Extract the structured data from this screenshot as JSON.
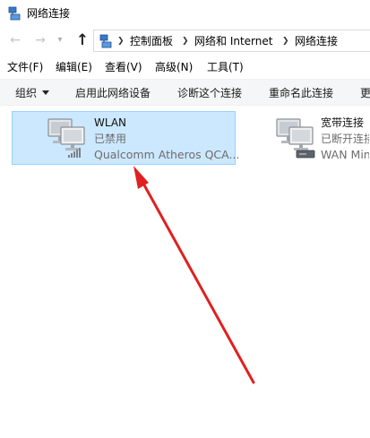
{
  "window": {
    "title": "网络连接"
  },
  "address": {
    "crumbs": [
      "控制面板",
      "网络和 Internet",
      "网络连接"
    ]
  },
  "menu": {
    "items": [
      "文件(F)",
      "编辑(E)",
      "查看(V)",
      "高级(N)",
      "工具(T)"
    ]
  },
  "commands": {
    "organize": "组织",
    "enable_device": "启用此网络设备",
    "diagnose": "诊断这个连接",
    "rename": "重命名此连接",
    "more": "更"
  },
  "connections": [
    {
      "name": "WLAN",
      "status": "已禁用",
      "device": "Qualcomm Atheros QCA...",
      "selected": true
    },
    {
      "name": "宽带连接",
      "status": "已断开连接",
      "device": "WAN Mini",
      "selected": false
    }
  ],
  "colors": {
    "selection_fill": "#cce8ff",
    "selection_border": "#99d1ff",
    "annotation_arrow": "#e02020"
  }
}
